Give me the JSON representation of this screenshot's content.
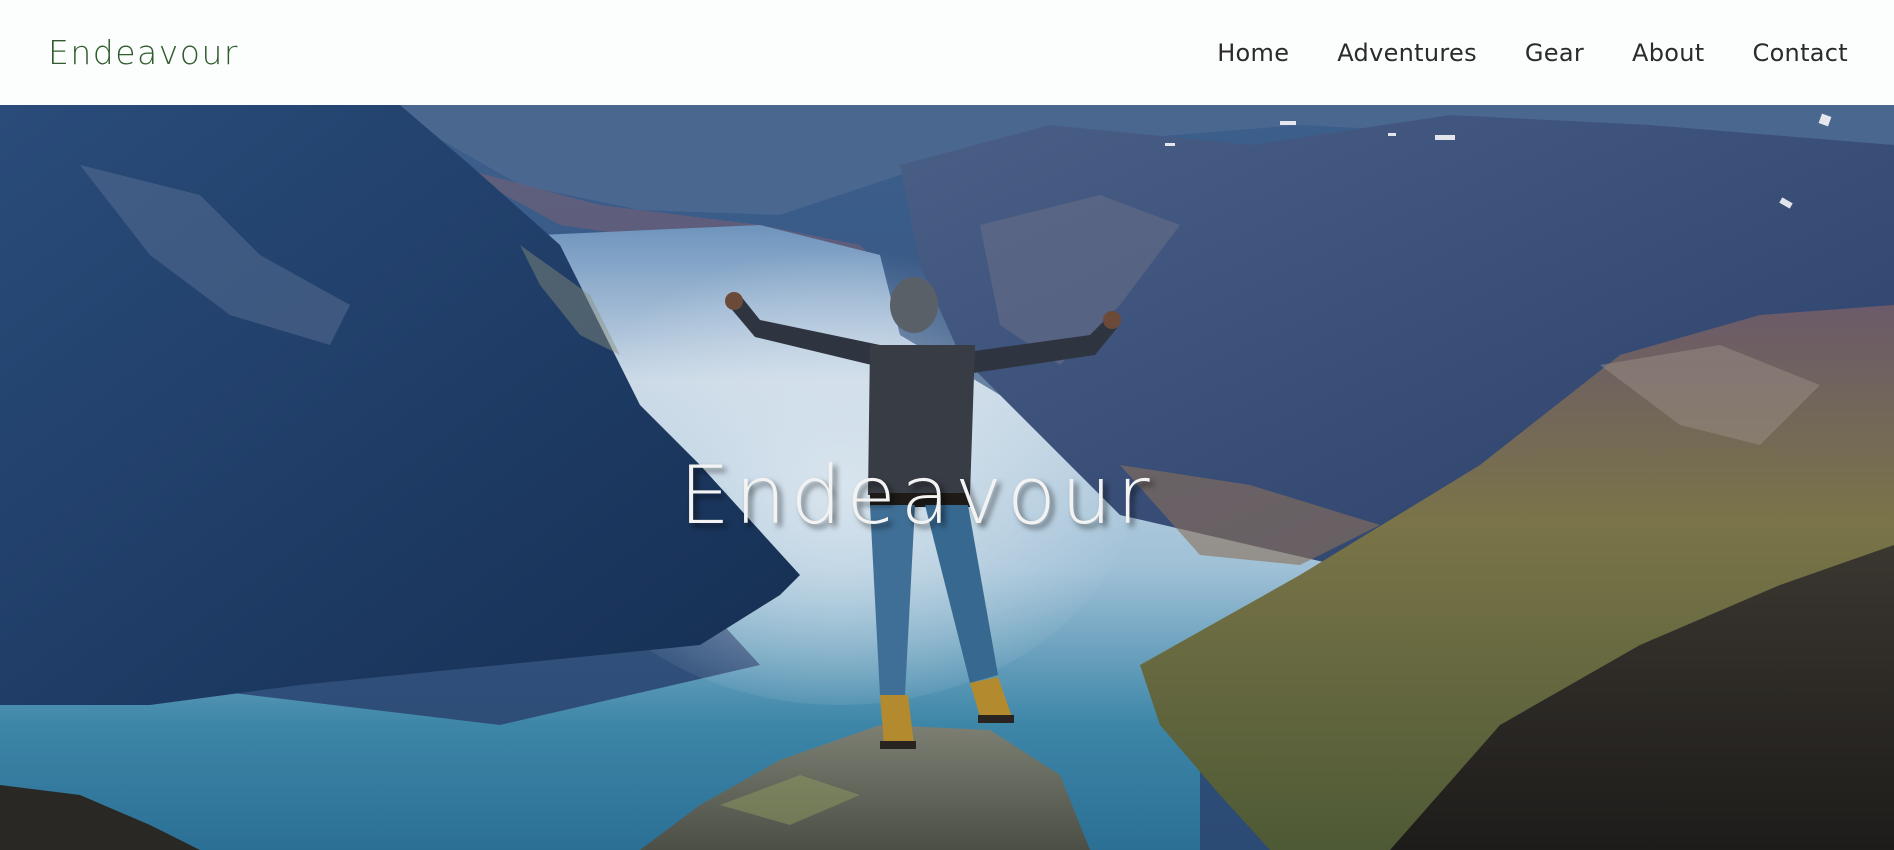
{
  "header": {
    "brand": "Endeavour",
    "nav": [
      {
        "label": "Home"
      },
      {
        "label": "Adventures"
      },
      {
        "label": "Gear"
      },
      {
        "label": "About"
      },
      {
        "label": "Contact"
      }
    ]
  },
  "hero": {
    "title": "Endeavour",
    "image_subject": "hiker with raised arms on rock above fjord valley"
  },
  "colors": {
    "brand": "#2f5b2d",
    "nav_text": "#2b2b2b",
    "header_bg": "#fcfdfd",
    "hero_title": "#f3f3f3"
  }
}
